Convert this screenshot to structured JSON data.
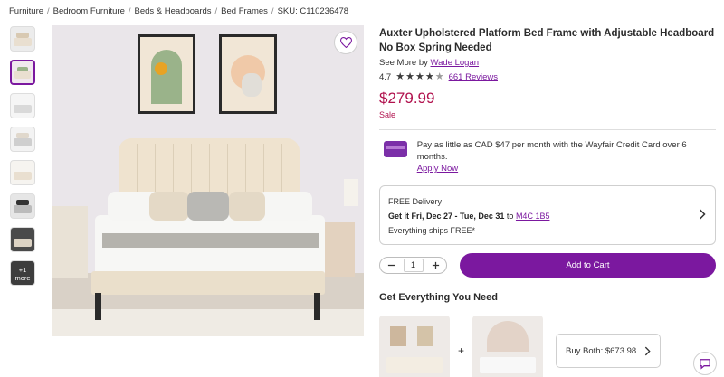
{
  "breadcrumb": {
    "items": [
      "Furniture",
      "Bedroom Furniture",
      "Beds & Headboards",
      "Bed Frames"
    ],
    "separator": "/",
    "sku": "SKU: C110236478"
  },
  "gallery": {
    "more_label": "+1 more",
    "active_index": 1
  },
  "product": {
    "title": "Auxter Upholstered Platform Bed Frame with Adjustable Headboard No Box Spring Needed",
    "see_more_prefix": "See More by",
    "brand": "Wade Logan",
    "rating": "4.7",
    "rating_stars": 4.5,
    "reviews": "661 Reviews",
    "price": "$279.99",
    "sale_label": "Sale"
  },
  "credit": {
    "text": "Pay as little as CAD $47 per month with the Wayfair Credit Card over 6 months.",
    "link": "Apply Now"
  },
  "delivery": {
    "heading": "FREE Delivery",
    "get_it": "Get it Fri, Dec 27 - Tue, Dec 31",
    "to": "to",
    "postal": "M4C 1B5",
    "note": "Everything ships FREE*"
  },
  "cart": {
    "quantity": "1",
    "add_label": "Add to Cart"
  },
  "bundle": {
    "heading": "Get Everything You Need",
    "plus": "+",
    "buy_both": "Buy Both: $673.98"
  },
  "colors": {
    "accent": "#7b189f",
    "price": "#b1124e"
  }
}
